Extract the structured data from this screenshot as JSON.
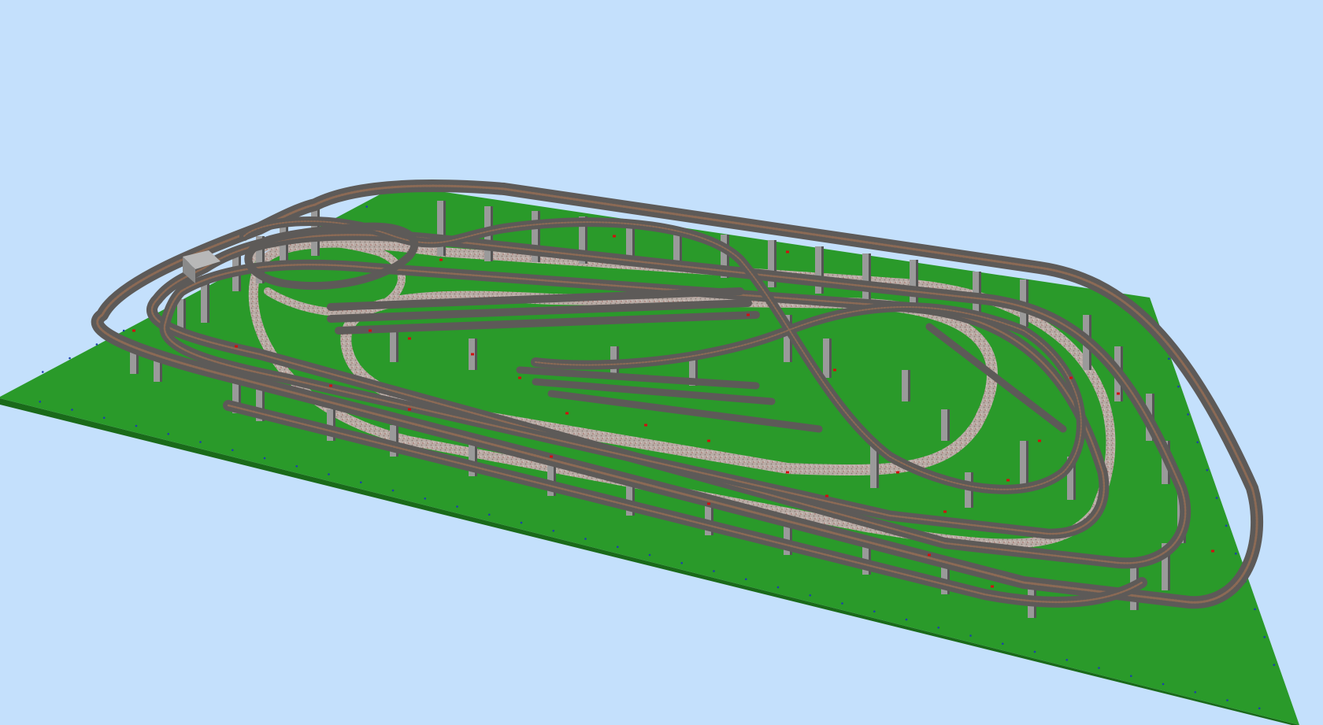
{
  "scene": {
    "background_color": "#c4e0fc",
    "baseboard_color": "#2a9a2a",
    "baseboard_edge_color": "#1a6a1a",
    "ballast_color": "#b9aca6",
    "track_bed_color": "#5d5a58",
    "rail_color": "#8b6a55",
    "pier_color": "#9a9a9a",
    "pier_shadow_color": "#555555",
    "marker_color": "#d01010",
    "grid_dot_color": "#1d3faa"
  }
}
